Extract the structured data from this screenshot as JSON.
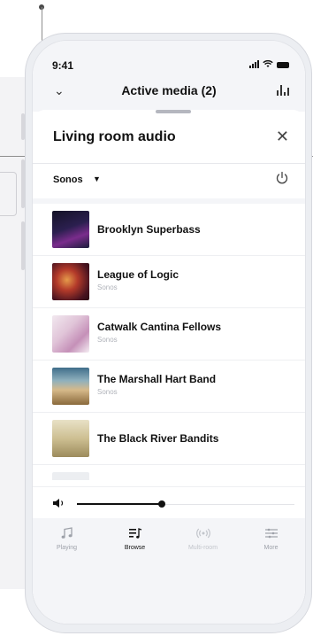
{
  "status_bar": {
    "time": "9:41"
  },
  "header": {
    "title": "Active media (2)"
  },
  "sheet": {
    "title": "Living room audio",
    "source": {
      "label": "Sonos"
    }
  },
  "items": [
    {
      "title": "Brooklyn Superbass",
      "subtitle": ""
    },
    {
      "title": "League of Logic",
      "subtitle": "Sonos"
    },
    {
      "title": "Catwalk Cantina Fellows",
      "subtitle": "Sonos"
    },
    {
      "title": "The Marshall Hart Band",
      "subtitle": "Sonos"
    },
    {
      "title": "The Black River Bandits",
      "subtitle": ""
    }
  ],
  "volume": {
    "level_fraction": 0.39
  },
  "tabs": [
    {
      "label": "Playing",
      "icon": "music-note-icon"
    },
    {
      "label": "Browse",
      "icon": "browse-icon"
    },
    {
      "label": "Multi-room",
      "icon": "multi-room-icon"
    },
    {
      "label": "More",
      "icon": "more-icon"
    }
  ],
  "colors": {
    "accent": "#111111",
    "muted": "#9da1a9"
  }
}
